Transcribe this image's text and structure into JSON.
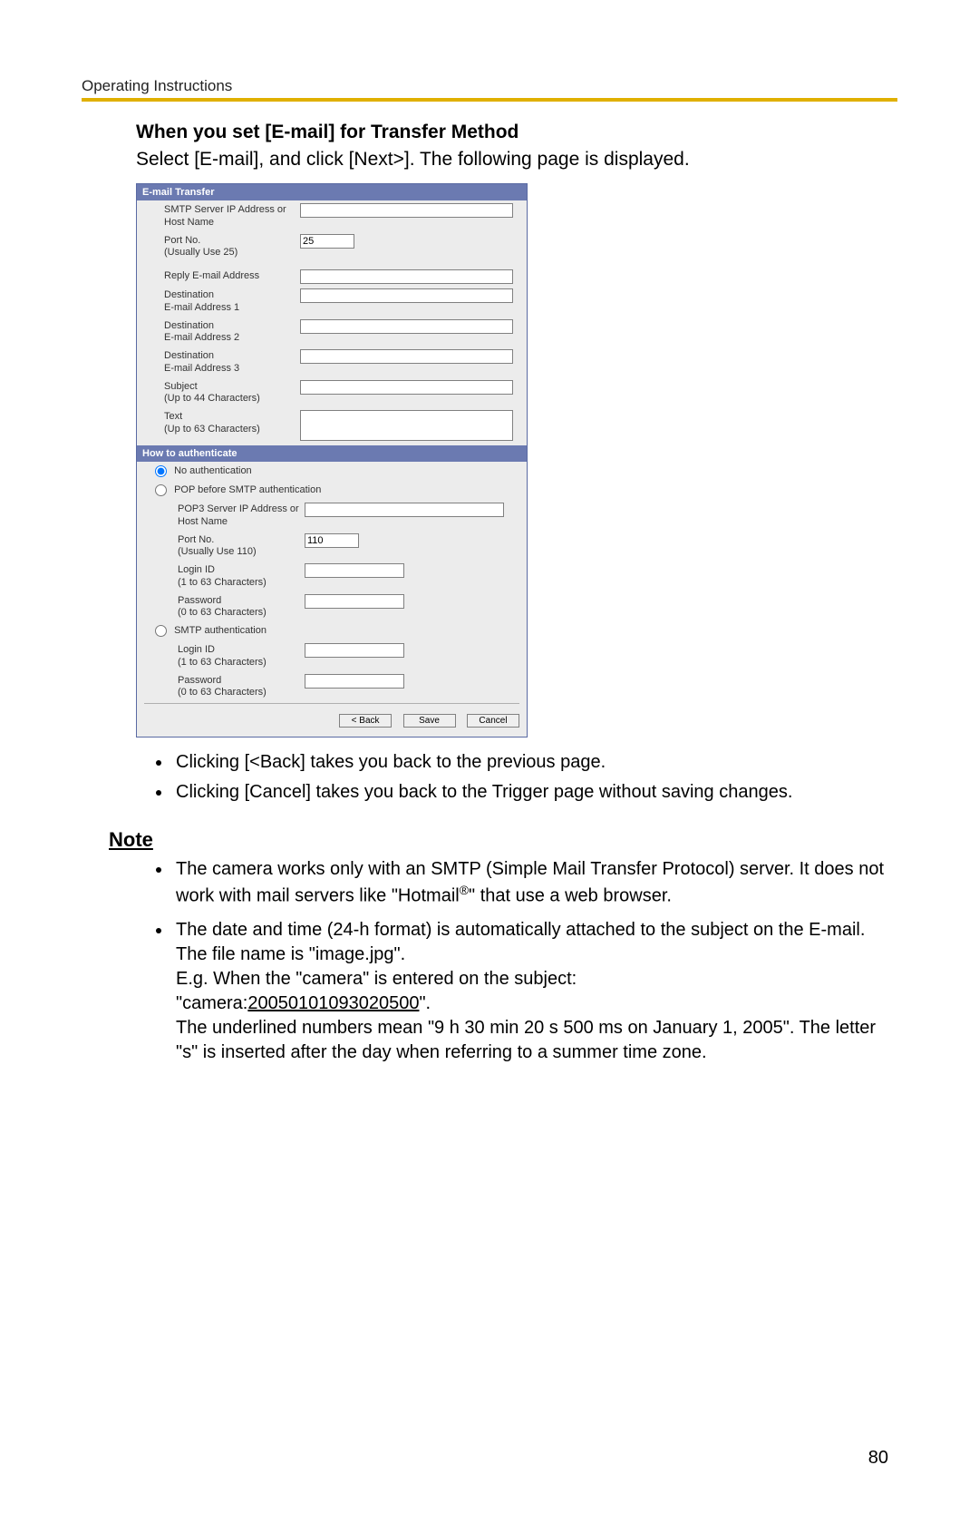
{
  "header": {
    "running_head": "Operating Instructions"
  },
  "section": {
    "heading": "When you set [E-mail] for Transfer Method",
    "intro": "Select [E-mail], and click [Next>]. The following page is displayed."
  },
  "ui": {
    "email_transfer_header": "E-mail Transfer",
    "rows": {
      "smtp_label": "SMTP Server IP Address or Host Name",
      "smtp_value": "",
      "port_label": "Port No.\n(Usually Use 25)",
      "port_value": "25",
      "reply_label": "Reply E-mail Address",
      "reply_value": "",
      "dest1_label": "Destination\nE-mail Address 1",
      "dest1_value": "",
      "dest2_label": "Destination\nE-mail Address 2",
      "dest2_value": "",
      "dest3_label": "Destination\nE-mail Address 3",
      "dest3_value": "",
      "subject_label": "Subject\n(Up to 44 Characters)",
      "subject_value": "",
      "text_label": "Text\n(Up to 63 Characters)",
      "text_value": ""
    },
    "auth": {
      "header": "How to authenticate",
      "opt_none": "No authentication",
      "opt_pop": "POP before SMTP authentication",
      "pop3_label": "POP3 Server IP Address or Host Name",
      "pop3_value": "",
      "pop3_port_label": "Port No.\n(Usually Use 110)",
      "pop3_port_value": "110",
      "pop_login_label": "Login ID\n(1 to 63 Characters)",
      "pop_login_value": "",
      "pop_pw_label": "Password\n(0 to 63 Characters)",
      "pop_pw_value": "",
      "opt_smtp": "SMTP authentication",
      "smtp_login_label": "Login ID\n(1 to 63 Characters)",
      "smtp_login_value": "",
      "smtp_pw_label": "Password\n(0 to 63 Characters)",
      "smtp_pw_value": ""
    },
    "buttons": {
      "back": "< Back",
      "save": "Save",
      "cancel": "Cancel"
    }
  },
  "bullets": {
    "b1": "Clicking [<Back] takes you back to the previous page.",
    "b2": "Clicking [Cancel] takes you back to the Trigger page without saving changes."
  },
  "note": {
    "heading": "Note",
    "n1a": "The camera works only with an SMTP (Simple Mail Transfer Protocol) server. It does not work with mail servers like \"Hotmail",
    "n1b": "\" that use a web browser.",
    "n2a": "The date and time (24-h format) is automatically attached to the subject on the E-mail. The file name is \"image.jpg\".",
    "n2b": "E.g. When the \"camera\" is entered on the subject:",
    "n2c_pre": "\"camera:",
    "n2c_num": "20050101093020500",
    "n2c_post": "\".",
    "n2d": "The underlined numbers mean \"9 h 30 min 20 s 500 ms on January 1, 2005\". The letter \"s\" is inserted after the day when referring to a summer time zone.",
    "reg_mark": "®"
  },
  "page_number": "80"
}
